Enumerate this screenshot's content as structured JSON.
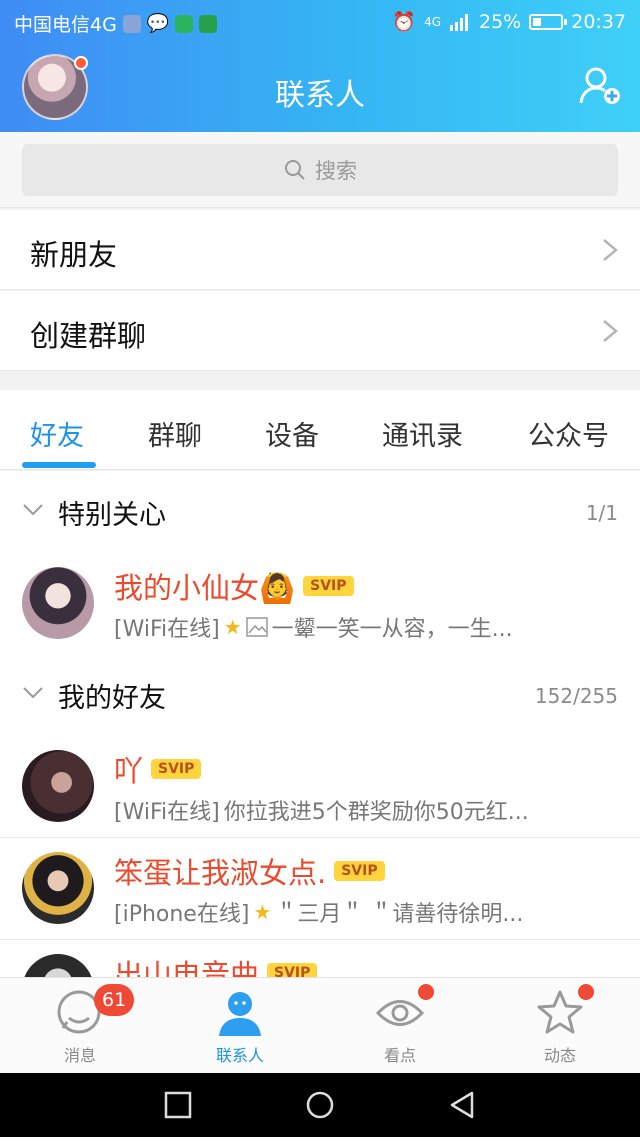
{
  "status_bar": {
    "carrier": "中国电信4G",
    "network": "4G",
    "battery": "25%",
    "time": "20:37"
  },
  "header": {
    "title": "联系人",
    "avatar_has_notification": true,
    "add_contact_icon": "add-user-icon"
  },
  "search": {
    "placeholder": "搜索",
    "icon": "search-icon"
  },
  "menu": [
    {
      "label": "新朋友"
    },
    {
      "label": "创建群聊"
    }
  ],
  "tabs": [
    {
      "label": "好友",
      "active": true
    },
    {
      "label": "群聊",
      "active": false
    },
    {
      "label": "设备",
      "active": false
    },
    {
      "label": "通讯录",
      "active": false
    },
    {
      "label": "公众号",
      "active": false
    }
  ],
  "groups": {
    "special": {
      "title": "特别关心",
      "count": "1/1"
    },
    "friends": {
      "title": "我的好友",
      "count": "152/255"
    }
  },
  "friends": [
    {
      "name": "我的小仙女🙆",
      "badge": "SVIP",
      "status": "[WiFi在线]",
      "has_star": true,
      "has_image": true,
      "message": "一颦一笑一从容，一生..."
    },
    {
      "name": "吖",
      "badge": "SVIP",
      "status": "[WiFi在线]",
      "has_star": false,
      "has_image": false,
      "message": "你拉我进5个群奖励你50元红..."
    },
    {
      "name": "笨蛋让我淑女点.",
      "badge": "SVIP",
      "status": "[iPhone在线]",
      "has_star": true,
      "has_image": false,
      "message": "＂三月＂ ＂请善待徐明..."
    },
    {
      "name": "出山电音曲",
      "badge": "SVIP"
    }
  ],
  "bottom_nav": [
    {
      "label": "消息",
      "badge": "61",
      "icon": "message-icon"
    },
    {
      "label": "联系人",
      "icon": "contacts-icon",
      "active": true
    },
    {
      "label": "看点",
      "icon": "eye-icon",
      "dot": true
    },
    {
      "label": "动态",
      "icon": "star-icon",
      "dot": true
    }
  ],
  "colors": {
    "accent": "#1f93e6",
    "name_red": "#ec4a2e",
    "svip_bg": "#ffd43c",
    "badge_red": "#f04a37"
  }
}
